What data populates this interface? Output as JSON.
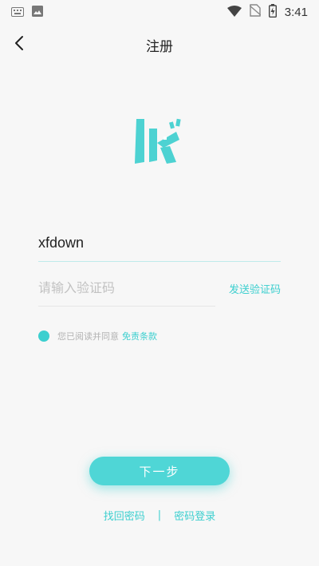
{
  "status_bar": {
    "time": "3:41"
  },
  "header": {
    "title": "注册"
  },
  "form": {
    "username_value": "xfdown",
    "code_placeholder": "请输入验证码",
    "send_code_label": "发送验证码",
    "agree_text": "您已阅读并同意",
    "terms_label": "免责条款"
  },
  "actions": {
    "next_label": "下一步",
    "find_password_label": "找回密码",
    "separator": "|",
    "password_login_label": "密码登录"
  },
  "colors": {
    "accent": "#3ccfcf",
    "button": "#4fd6d6"
  },
  "icons": {
    "status_left": [
      "keyboard-icon",
      "image-icon"
    ],
    "status_right": [
      "wifi-icon",
      "no-sim-icon",
      "battery-icon"
    ],
    "nav": "back-arrow-icon",
    "logo": "app-logo"
  }
}
